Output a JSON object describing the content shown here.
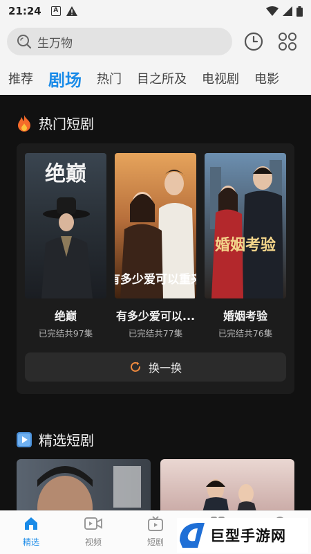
{
  "status_bar": {
    "time": "21:24",
    "left_icons": [
      "a-icon",
      "warning-icon"
    ],
    "right_icons": [
      "wifi-icon",
      "signal-icon",
      "battery-icon"
    ]
  },
  "search": {
    "placeholder_text": "生万物"
  },
  "tabs": [
    {
      "label": "推荐",
      "active": false
    },
    {
      "label": "剧场",
      "active": true
    },
    {
      "label": "热门",
      "active": false
    },
    {
      "label": "目之所及",
      "active": false
    },
    {
      "label": "电视剧",
      "active": false
    },
    {
      "label": "电影",
      "active": false
    }
  ],
  "hot_section": {
    "title": "热门短剧",
    "icon": "fire-icon",
    "items": [
      {
        "title": "绝巅",
        "status": "已完结共97集",
        "poster_text": "绝巅"
      },
      {
        "title": "有多少爱可以...",
        "status": "已完结共77集",
        "poster_text": "有多少爱可以重来"
      },
      {
        "title": "婚姻考验",
        "status": "已完结共76集",
        "poster_text": "婚姻考验"
      }
    ],
    "refresh_label": "换一换"
  },
  "featured_section": {
    "title": "精选短剧",
    "icon": "play-icon"
  },
  "bottom_nav": [
    {
      "label": "精选",
      "icon": "home-icon",
      "active": true
    },
    {
      "label": "视频",
      "icon": "video-icon",
      "active": false
    },
    {
      "label": "短剧",
      "icon": "tv-icon",
      "active": false
    },
    {
      "label": "",
      "icon": "grid-icon",
      "active": false
    },
    {
      "label": "",
      "icon": "user-icon",
      "active": false
    }
  ],
  "watermark": {
    "text": "巨型手游网"
  },
  "colors": {
    "accent": "#1a8be8",
    "dark_bg": "#111111",
    "card_bg": "#1c1c1c",
    "refresh_icon": "#f08a3e"
  }
}
